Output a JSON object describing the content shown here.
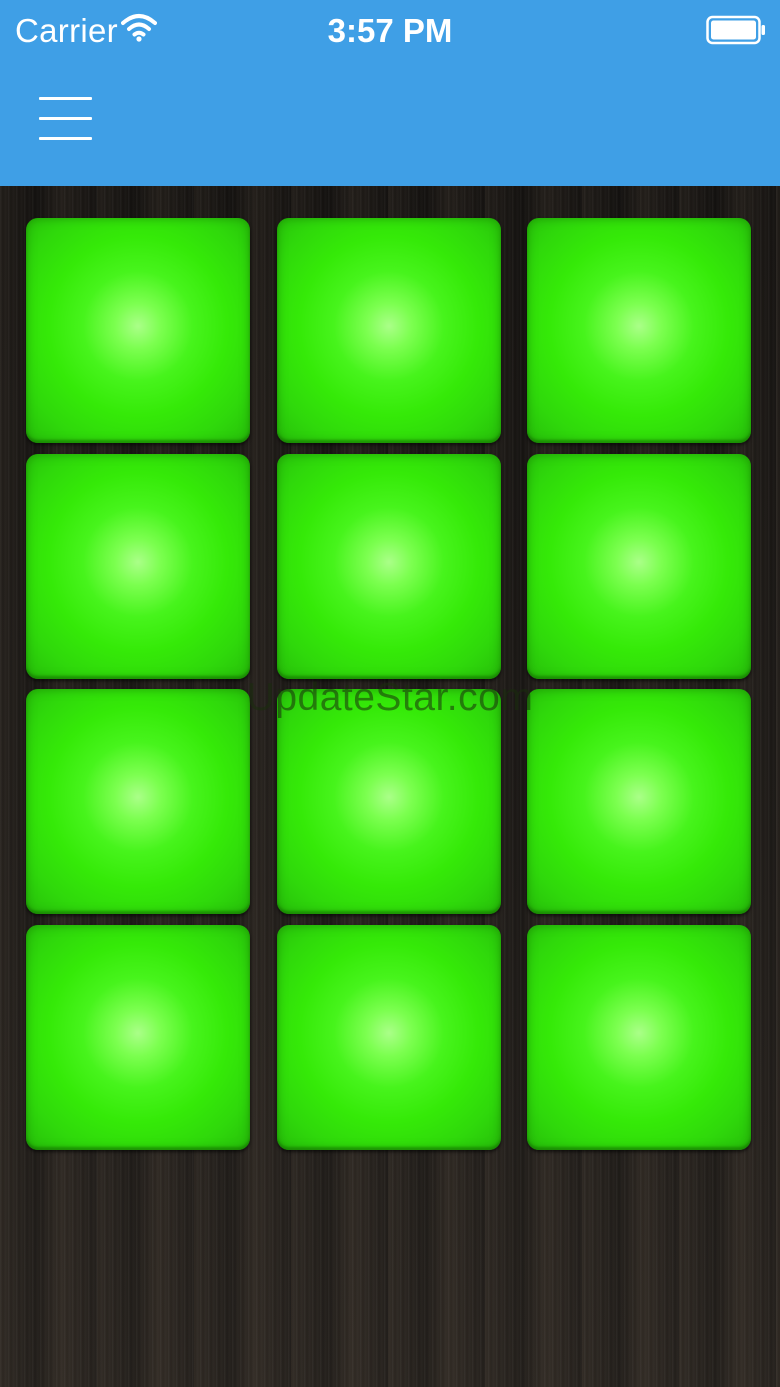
{
  "status_bar": {
    "carrier": "Carrier",
    "time": "3:57 PM",
    "wifi_icon": "wifi-icon",
    "battery_icon": "battery-icon"
  },
  "nav": {
    "menu_icon": "hamburger-menu-icon",
    "color": "#3f9fe6"
  },
  "pads": {
    "rows": 4,
    "columns": 3,
    "color": "#35ea08",
    "glow_color": "#aaff88"
  },
  "watermark": "UpdateStar.com"
}
